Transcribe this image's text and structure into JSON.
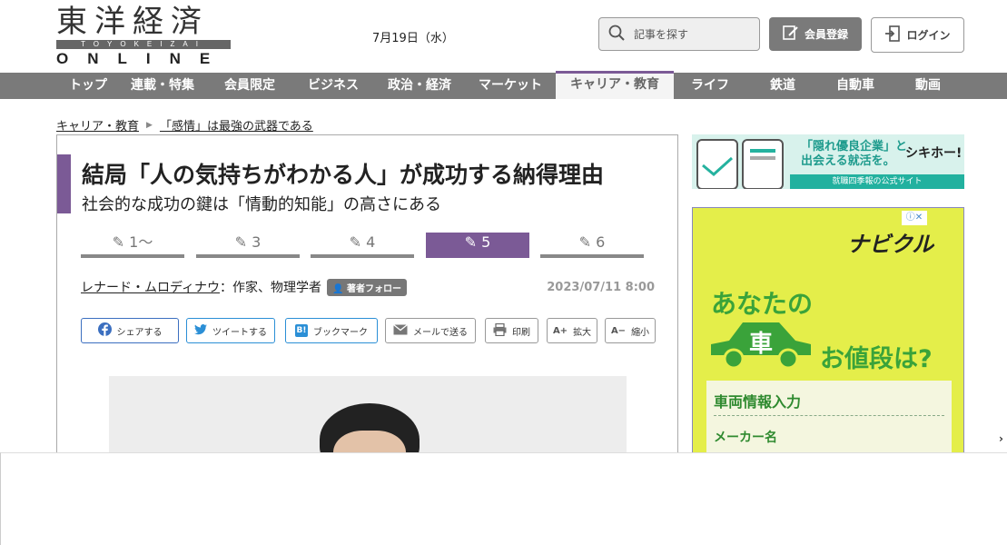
{
  "header": {
    "logo_kanji": "東洋経済",
    "logo_romaji": "TOYOKEIZAI",
    "logo_online": "ONLINE",
    "date": "7月19日（水）",
    "search_placeholder": "記事を探す",
    "register_label": "会員登録",
    "login_label": "ログイン"
  },
  "nav": {
    "items": [
      "トップ",
      "連載・特集",
      "会員限定",
      "ビジネス",
      "政治・経済",
      "マーケット",
      "キャリア・教育",
      "ライフ",
      "鉄道",
      "自動車",
      "動画"
    ],
    "active": "キャリア・教育",
    "accent_color": "#7b5a96"
  },
  "breadcrumb": {
    "parent": "キャリア・教育",
    "current": "「感情」は最強の武器である"
  },
  "article": {
    "title": "結局「人の気持ちがわかる人」が成功する納得理由",
    "subtitle": "社会的な成功の鍵は「情動的知能」の高さにある",
    "pages": [
      "1〜",
      "3",
      "4",
      "5",
      "6"
    ],
    "active_page": "5",
    "author_name": "レナード・ムロディナウ",
    "author_role": "：作家、物理学者",
    "follow_label": "著者フォロー",
    "published": "2023/07/11 8:00",
    "share": {
      "facebook": "シェアする",
      "twitter": "ツイートする",
      "hatena": "ブックマーク",
      "hatena_icon": "B!",
      "mail": "メールで送る",
      "print": "印刷",
      "enlarge_icon": "A+",
      "enlarge": "拡大",
      "shrink_icon": "A−",
      "shrink": "縮小"
    }
  },
  "sidebar": {
    "banner_text_line1": "「隠れ優良企業」と",
    "banner_text_line2": "出会える就活を。",
    "banner_brand": "シキホー!",
    "banner_footer": "就職四季報の公式サイト",
    "ad_brand": "ナビクル",
    "ad_line1": "あなたの",
    "ad_car_char": "車",
    "ad_line2": "お値段は?",
    "ad_panel_title": "車両情報入力",
    "ad_panel_label": "メーカー名"
  },
  "overlay": {
    "chevron": "›"
  }
}
